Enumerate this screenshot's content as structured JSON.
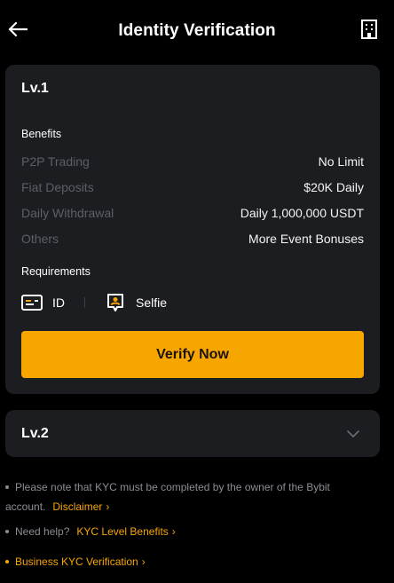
{
  "header": {
    "title": "Identity Verification",
    "back_icon": "arrow-left-icon",
    "right_icon": "building-icon"
  },
  "lv1": {
    "title": "Lv.1",
    "benefits_label": "Benefits",
    "benefits": [
      {
        "key": "P2P Trading",
        "value": "No Limit"
      },
      {
        "key": "Fiat Deposits",
        "value": "$20K Daily"
      },
      {
        "key": "Daily Withdrawal",
        "value": "Daily 1,000,000 USDT"
      },
      {
        "key": "Others",
        "value": "More Event Bonuses"
      }
    ],
    "requirements_label": "Requirements",
    "requirements": [
      {
        "label": "ID",
        "icon": "id-card-icon"
      },
      {
        "label": "Selfie",
        "icon": "selfie-icon"
      }
    ],
    "verify_button": "Verify Now"
  },
  "lv2": {
    "title": "Lv.2",
    "icon": "chevron-down-icon"
  },
  "notes": {
    "note1_text": "Please note that KYC must be completed by the owner of the Bybit account.",
    "note1_link": "Disclaimer",
    "note2_text": "Need help?",
    "note2_link": "KYC Level Benefits",
    "note3_link": "Business KYC Verification"
  },
  "colors": {
    "background": "#000000",
    "card": "#1c1d20",
    "accent": "#f7a600",
    "muted_text": "#5c5f66"
  }
}
